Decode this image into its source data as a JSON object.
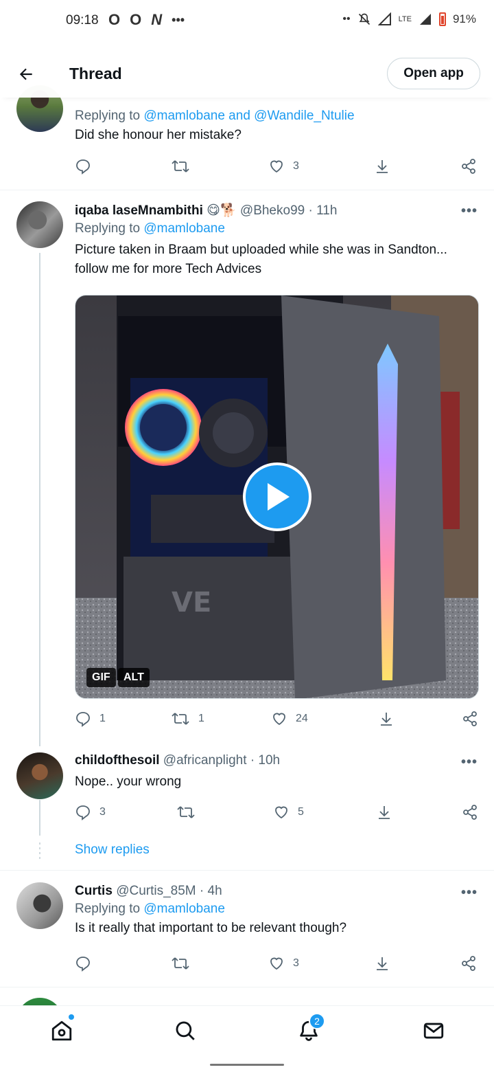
{
  "status_bar": {
    "time": "09:18",
    "left_icons": [
      "O",
      "O",
      "N",
      "•••"
    ],
    "network": "LTE",
    "battery": "91%"
  },
  "header": {
    "title": "Thread",
    "open_app": "Open app"
  },
  "tweets": [
    {
      "replying_prefix": "Replying to ",
      "replying_mentions": "@mamlobane and @Wandile_Ntulie",
      "text": "Did she honour her mistake?",
      "likes": "3"
    },
    {
      "name": "iqaba laseMnambithi",
      "emoji": "😋🐕",
      "handle": "@Bheko99",
      "time": "· 11h",
      "replying_prefix": "Replying to ",
      "replying_mentions": "@mamlobane",
      "text": "Picture taken in Braam but uploaded while she was in Sandton... follow me for more Tech Advices",
      "media_badges": [
        "GIF",
        "ALT"
      ],
      "replies": "1",
      "retweets": "1",
      "likes": "24"
    },
    {
      "name": "childofthesoil",
      "handle": "@africanplight",
      "time": "· 10h",
      "text": "Nope.. your wrong",
      "replies": "3",
      "likes": "5"
    },
    {
      "name": "Curtis",
      "handle": "@Curtis_85M",
      "time": "· 4h",
      "replying_prefix": "Replying to ",
      "replying_mentions": "@mamlobane",
      "text": "Is it really that important to be relevant though?",
      "likes": "3"
    }
  ],
  "show_replies": "Show replies",
  "more_label": "•••",
  "bottom_nav": {
    "notification_count": "2",
    "icons": [
      "home-icon",
      "search-icon",
      "bell-icon",
      "mail-icon"
    ]
  },
  "colors": {
    "accent": "#1d9bf0",
    "text": "#0f1419",
    "secondary": "#536471"
  }
}
